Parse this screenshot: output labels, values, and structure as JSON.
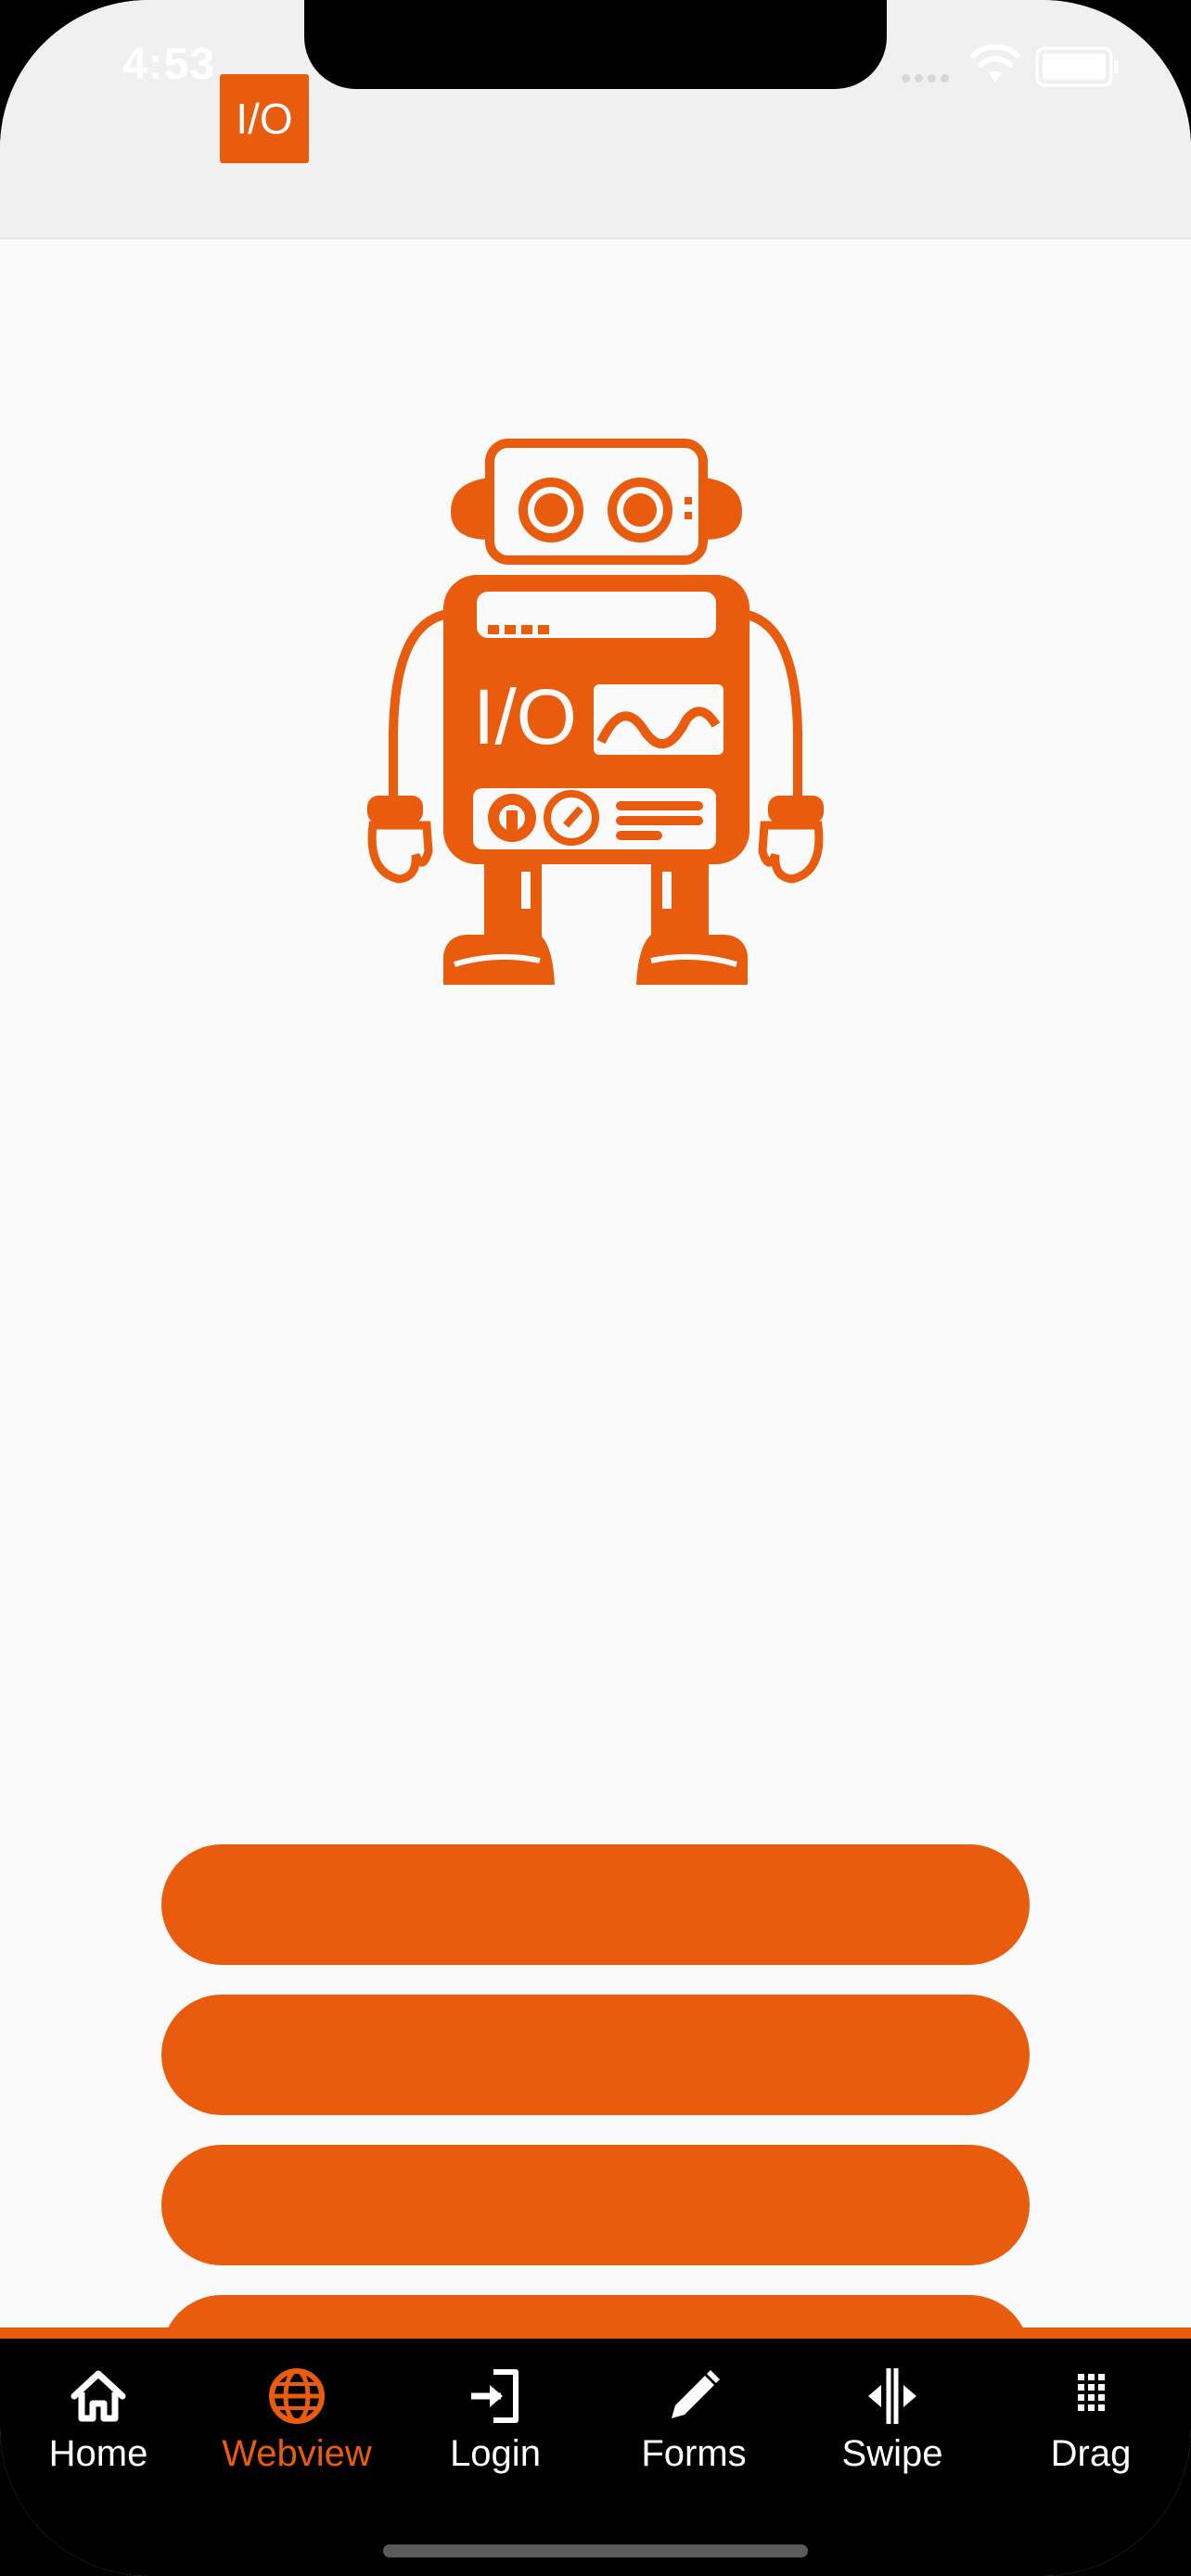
{
  "status_bar": {
    "time": "4:53"
  },
  "header": {
    "logo_text": "I/O"
  },
  "robot": {
    "screen_text": "I/O"
  },
  "buttons": [
    {
      "label": ""
    },
    {
      "label": ""
    },
    {
      "label": ""
    },
    {
      "label": ""
    }
  ],
  "tabs": [
    {
      "label": "Home",
      "icon": "home-icon",
      "active": false
    },
    {
      "label": "Webview",
      "icon": "globe-icon",
      "active": true
    },
    {
      "label": "Login",
      "icon": "login-icon",
      "active": false
    },
    {
      "label": "Forms",
      "icon": "pencil-icon",
      "active": false
    },
    {
      "label": "Swipe",
      "icon": "swipe-icon",
      "active": false
    },
    {
      "label": "Drag",
      "icon": "grid-icon",
      "active": false
    }
  ],
  "colors": {
    "accent": "#e95b0d",
    "header_bg": "#f0f0f0",
    "page_bg": "#fafafa",
    "tabbar_bg": "#000000"
  }
}
